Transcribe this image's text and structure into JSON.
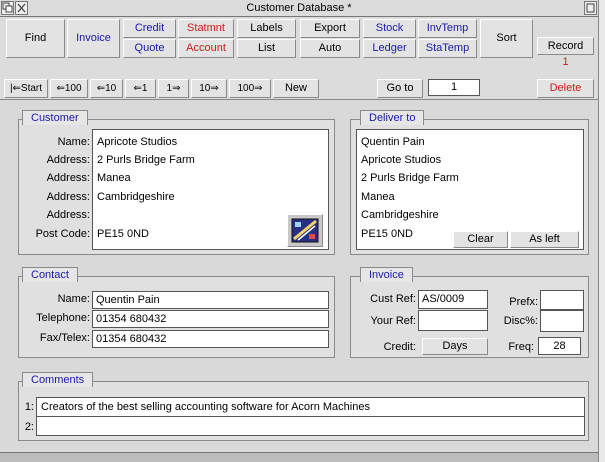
{
  "window": {
    "title": "Customer Database *"
  },
  "toolbar": {
    "find": "Find",
    "invoice": "Invoice",
    "credit": "Credit",
    "statmnt": "Statmnt",
    "labels": "Labels",
    "export": "Export",
    "stock": "Stock",
    "invtemp": "InvTemp",
    "quote": "Quote",
    "account": "Account",
    "list": "List",
    "auto": "Auto",
    "ledger": "Ledger",
    "statemp": "StaTemp",
    "sort": "Sort",
    "record_label": "Record",
    "record_number": "1",
    "delete": "Delete",
    "nav": [
      "|⇐Start",
      "⇐100",
      "⇐10",
      "⇐1",
      "1⇒",
      "10⇒",
      "100⇒"
    ],
    "new": "New",
    "goto": "Go to",
    "goto_value": "1"
  },
  "customer": {
    "heading": "Customer",
    "labels": [
      "Name:",
      "Address:",
      "Address:",
      "Address:",
      "Address:",
      "Post Code:"
    ],
    "values": [
      "Apricote Studios",
      "2 Purls Bridge Farm",
      "Manea",
      "Cambridgeshire",
      "",
      "PE15 0ND"
    ],
    "icon": "paint-palette-icon"
  },
  "deliver": {
    "heading": "Deliver to",
    "lines": [
      "Quentin Pain",
      "Apricote Studios",
      "2 Purls Bridge Farm",
      "Manea",
      "Cambridgeshire",
      "PE15 0ND"
    ],
    "clear": "Clear",
    "asleft": "As left"
  },
  "contact": {
    "heading": "Contact",
    "labels": [
      "Name:",
      "Telephone:",
      "Fax/Telex:"
    ],
    "values": [
      "Quentin Pain",
      "01354 680432",
      "01354 680432"
    ]
  },
  "invoice": {
    "heading": "Invoice",
    "custref_label": "Cust Ref:",
    "custref": "AS/0009",
    "yourref_label": "Your Ref:",
    "yourref": "",
    "prefix_label": "Prefx:",
    "prefix": "",
    "disc_label": "Disc%:",
    "disc": "",
    "credit_label": "Credit:",
    "credit_value": "Days",
    "freq_label": "Freq:",
    "freq": "28"
  },
  "comments": {
    "heading": "Comments",
    "line_labels": [
      "1:",
      "2:"
    ],
    "lines": [
      "Creators of the best selling accounting software for Acorn Machines",
      ""
    ]
  },
  "colors": {
    "accent_blue": "#1a1aa8",
    "alert_red": "#d21a1a",
    "window_grey": "#d9d9d9"
  }
}
